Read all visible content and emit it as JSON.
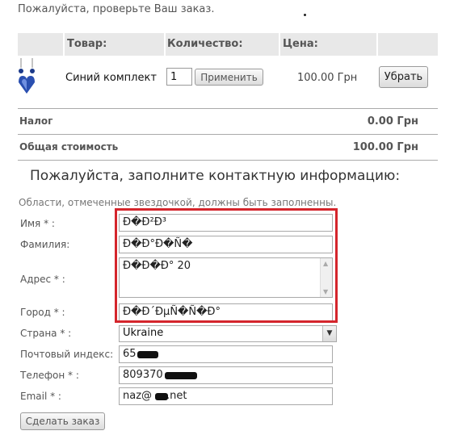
{
  "intro": "Пожалуйста, проверьте Ваш заказ.",
  "table": {
    "headers": [
      "Товар:",
      "Количество:",
      "Цена:"
    ],
    "item": {
      "name": "Синий комплект",
      "quantity": "1",
      "apply_label": "Применить",
      "price": "100.00 Грн",
      "remove_label": "Убрать",
      "image_icon": "earrings-thumbnail"
    },
    "tax_label": "Налог",
    "tax_value": "0.00 Грн",
    "total_label": "Общая стоимость",
    "total_value": "100.00 Грн"
  },
  "contact": {
    "title": "Пожалуйста, заполните контактную информацию:",
    "hint": "Области, отмеченные звездочкой, должны быть заполненны.",
    "fields": {
      "first_name": {
        "label": "Имя * :",
        "value": "Ð�Ð²Ð³"
      },
      "last_name": {
        "label": "Фамилия:",
        "value": "Ð�Ð°Ð�Ñ�"
      },
      "address": {
        "label": "Адрес * :",
        "value": "Ð�Ð�Ð° 20"
      },
      "city": {
        "label": "Город * :",
        "value": "Ð�Ð´ÐµÑ�Ñ�Ð°"
      },
      "country": {
        "label": "Страна * :",
        "value": "Ukraine"
      },
      "postal": {
        "label": "Почтовый индекс:",
        "value": "65"
      },
      "phone": {
        "label": "Телефон * :",
        "value": "809370"
      },
      "email": {
        "label": "Email * :",
        "value_prefix": "naz@",
        "value_suffix": ".net"
      }
    },
    "submit_label": "Сделать заказ"
  },
  "colors": {
    "highlight": "#d4252c",
    "header_bg": "#e8e8e8"
  }
}
